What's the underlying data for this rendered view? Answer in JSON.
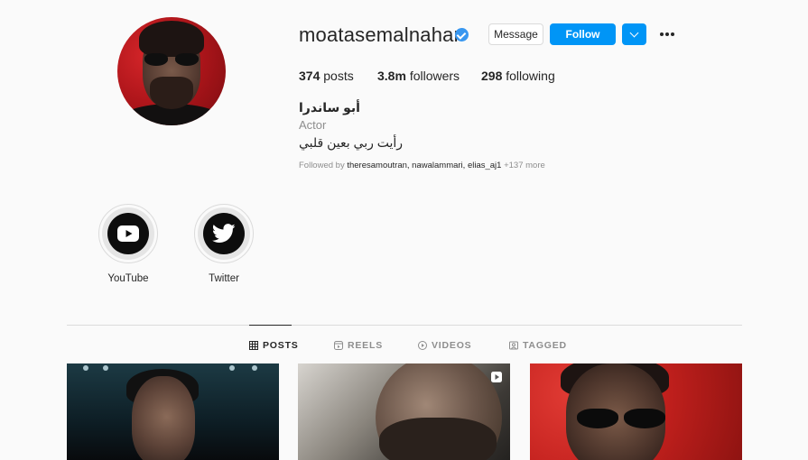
{
  "profile": {
    "username": "moatasemalnahar",
    "verified": true,
    "message_label": "Message",
    "follow_label": "Follow",
    "stats": {
      "posts_count": "374",
      "posts_label": "posts",
      "followers_count": "3.8m",
      "followers_label": "followers",
      "following_count": "298",
      "following_label": "following"
    },
    "full_name": "أبو ساندرا",
    "category": "Actor",
    "bio": "رأيت ربي بعين قلبي",
    "followed_by": {
      "prefix": "Followed by ",
      "users": [
        "theresamoutran",
        "nawalammari",
        "elias_aj1"
      ],
      "more": "+137 more"
    }
  },
  "highlights": [
    {
      "label": "YouTube",
      "icon": "youtube-icon"
    },
    {
      "label": "Twitter",
      "icon": "twitter-icon"
    }
  ],
  "tabs": [
    {
      "label": "POSTS",
      "icon": "grid-icon",
      "active": true
    },
    {
      "label": "REELS",
      "icon": "reels-icon",
      "active": false
    },
    {
      "label": "VIDEOS",
      "icon": "video-icon",
      "active": false
    },
    {
      "label": "TAGGED",
      "icon": "tagged-icon",
      "active": false
    }
  ],
  "colors": {
    "follow_blue": "#0095f6",
    "verified_blue": "#3897f0",
    "muted_text": "#8e8e8e"
  }
}
